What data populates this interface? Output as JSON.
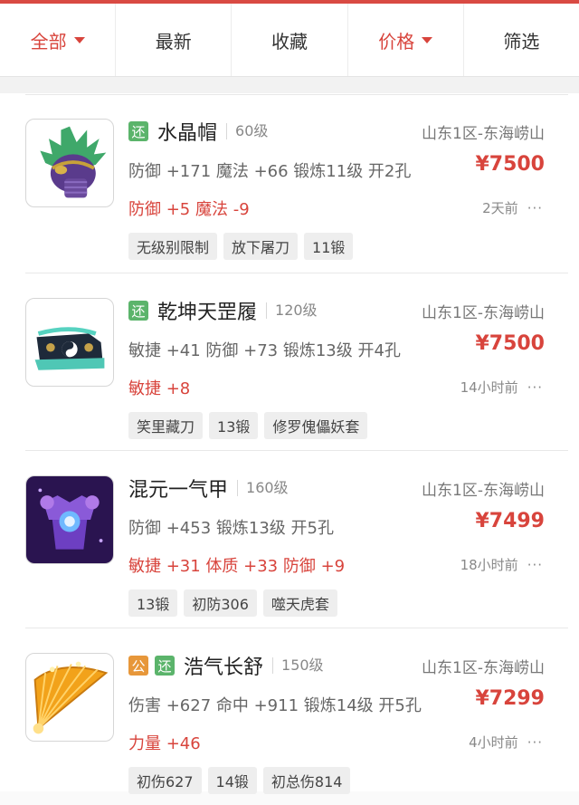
{
  "filter_bar": {
    "tabs": [
      {
        "label": "全部",
        "active": true,
        "has_caret": true
      },
      {
        "label": "最新",
        "active": false,
        "has_caret": false
      },
      {
        "label": "收藏",
        "active": false,
        "has_caret": false
      },
      {
        "label": "价格",
        "active": true,
        "has_caret": true
      },
      {
        "label": "筛选",
        "active": false,
        "has_caret": false
      }
    ]
  },
  "colors": {
    "accent_red": "#d8443c",
    "badge_green": "#5bb46b",
    "badge_orange": "#e7973a"
  },
  "items": [
    {
      "icon": "crystal-helmet-icon",
      "badges": [
        "还"
      ],
      "name": "水晶帽",
      "level": "60级",
      "server": "山东1区-东海崂山",
      "stats": "防御 +171 魔法 +66 锻炼11级 开2孔",
      "price": "¥7500",
      "bonus": "防御 +5 魔法 -9",
      "time": "2天前",
      "more": "···",
      "tags": [
        "无级别限制",
        "放下屠刀",
        "11锻"
      ]
    },
    {
      "icon": "shoes-icon",
      "badges": [
        "还"
      ],
      "name": "乾坤天罡履",
      "level": "120级",
      "server": "山东1区-东海崂山",
      "stats": "敏捷 +41 防御 +73 锻炼13级 开4孔",
      "price": "¥7500",
      "bonus": "敏捷 +8",
      "time": "14小时前",
      "more": "···",
      "tags": [
        "笑里藏刀",
        "13锻",
        "修罗傀儡妖套"
      ]
    },
    {
      "icon": "armor-icon",
      "badges": [],
      "name": "混元一气甲",
      "level": "160级",
      "server": "山东1区-东海崂山",
      "stats": "防御 +453 锻炼13级 开5孔",
      "price": "¥7499",
      "bonus": "敏捷 +31 体质 +33 防御 +9",
      "time": "18小时前",
      "more": "···",
      "tags": [
        "13锻",
        "初防306",
        "噬天虎套"
      ]
    },
    {
      "icon": "fan-icon",
      "badges": [
        "公",
        "还"
      ],
      "name": "浩气长舒",
      "level": "150级",
      "server": "山东1区-东海崂山",
      "stats": "伤害 +627 命中 +911 锻炼14级 开5孔",
      "price": "¥7299",
      "bonus": "力量 +46",
      "time": "4小时前",
      "more": "···",
      "tags": [
        "初伤627",
        "14锻",
        "初总伤814"
      ]
    }
  ]
}
